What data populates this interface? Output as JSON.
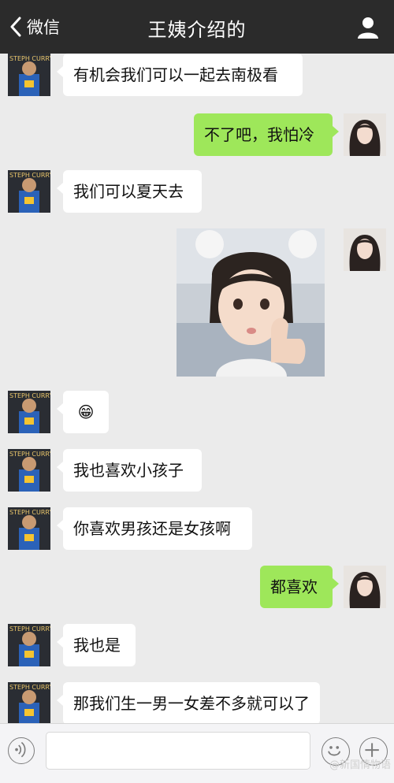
{
  "nav": {
    "back_label": "微信",
    "title": "王姨介绍的"
  },
  "messages": [
    {
      "side": "left",
      "type": "text",
      "text": "有机会我们可以一起去南极看"
    },
    {
      "side": "right",
      "type": "text",
      "text": "不了吧，我怕冷"
    },
    {
      "side": "left",
      "type": "text",
      "text": "我们可以夏天去"
    },
    {
      "side": "right",
      "type": "image",
      "image": "photo-of-child-giving-thumbs-up"
    },
    {
      "side": "left",
      "type": "emoji",
      "text": "😁"
    },
    {
      "side": "left",
      "type": "text",
      "text": "我也喜欢小孩子"
    },
    {
      "side": "left",
      "type": "text",
      "text": "你喜欢男孩还是女孩啊"
    },
    {
      "side": "right",
      "type": "text",
      "text": "都喜欢"
    },
    {
      "side": "left",
      "type": "text",
      "text": "我也是"
    },
    {
      "side": "left",
      "type": "text",
      "text": "那我们生一男一女差不多就可以了"
    }
  ],
  "avatars": {
    "left_jersey_text": "STEPH CURRY"
  },
  "input": {
    "value": "",
    "voice_icon": "voice-icon",
    "emoji_icon": "emoji-icon",
    "plus_icon": "plus-icon"
  },
  "watermark": "@新国情物语",
  "colors": {
    "navbar": "#2b2b2b",
    "background": "#ebebeb",
    "bubble_right": "#9ee75a",
    "bubble_left": "#ffffff"
  }
}
